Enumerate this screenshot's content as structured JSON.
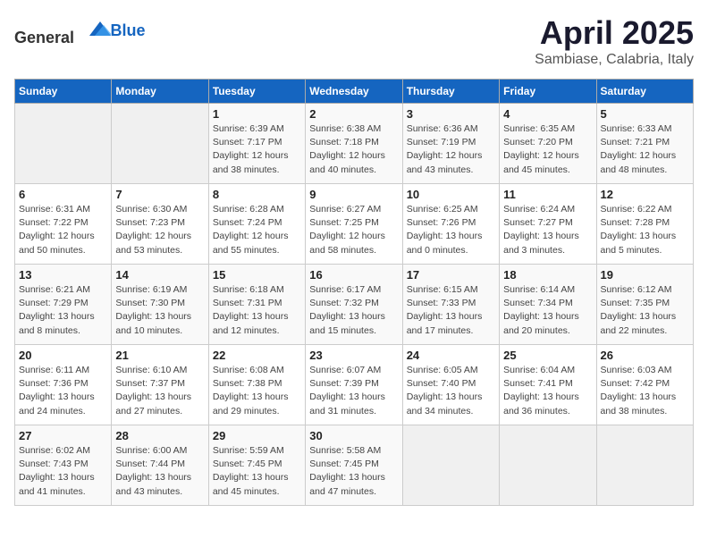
{
  "header": {
    "logo_general": "General",
    "logo_blue": "Blue",
    "month_title": "April 2025",
    "subtitle": "Sambiase, Calabria, Italy"
  },
  "days_of_week": [
    "Sunday",
    "Monday",
    "Tuesday",
    "Wednesday",
    "Thursday",
    "Friday",
    "Saturday"
  ],
  "weeks": [
    [
      {
        "day": "",
        "info": ""
      },
      {
        "day": "",
        "info": ""
      },
      {
        "day": "1",
        "info": "Sunrise: 6:39 AM\nSunset: 7:17 PM\nDaylight: 12 hours and 38 minutes."
      },
      {
        "day": "2",
        "info": "Sunrise: 6:38 AM\nSunset: 7:18 PM\nDaylight: 12 hours and 40 minutes."
      },
      {
        "day": "3",
        "info": "Sunrise: 6:36 AM\nSunset: 7:19 PM\nDaylight: 12 hours and 43 minutes."
      },
      {
        "day": "4",
        "info": "Sunrise: 6:35 AM\nSunset: 7:20 PM\nDaylight: 12 hours and 45 minutes."
      },
      {
        "day": "5",
        "info": "Sunrise: 6:33 AM\nSunset: 7:21 PM\nDaylight: 12 hours and 48 minutes."
      }
    ],
    [
      {
        "day": "6",
        "info": "Sunrise: 6:31 AM\nSunset: 7:22 PM\nDaylight: 12 hours and 50 minutes."
      },
      {
        "day": "7",
        "info": "Sunrise: 6:30 AM\nSunset: 7:23 PM\nDaylight: 12 hours and 53 minutes."
      },
      {
        "day": "8",
        "info": "Sunrise: 6:28 AM\nSunset: 7:24 PM\nDaylight: 12 hours and 55 minutes."
      },
      {
        "day": "9",
        "info": "Sunrise: 6:27 AM\nSunset: 7:25 PM\nDaylight: 12 hours and 58 minutes."
      },
      {
        "day": "10",
        "info": "Sunrise: 6:25 AM\nSunset: 7:26 PM\nDaylight: 13 hours and 0 minutes."
      },
      {
        "day": "11",
        "info": "Sunrise: 6:24 AM\nSunset: 7:27 PM\nDaylight: 13 hours and 3 minutes."
      },
      {
        "day": "12",
        "info": "Sunrise: 6:22 AM\nSunset: 7:28 PM\nDaylight: 13 hours and 5 minutes."
      }
    ],
    [
      {
        "day": "13",
        "info": "Sunrise: 6:21 AM\nSunset: 7:29 PM\nDaylight: 13 hours and 8 minutes."
      },
      {
        "day": "14",
        "info": "Sunrise: 6:19 AM\nSunset: 7:30 PM\nDaylight: 13 hours and 10 minutes."
      },
      {
        "day": "15",
        "info": "Sunrise: 6:18 AM\nSunset: 7:31 PM\nDaylight: 13 hours and 12 minutes."
      },
      {
        "day": "16",
        "info": "Sunrise: 6:17 AM\nSunset: 7:32 PM\nDaylight: 13 hours and 15 minutes."
      },
      {
        "day": "17",
        "info": "Sunrise: 6:15 AM\nSunset: 7:33 PM\nDaylight: 13 hours and 17 minutes."
      },
      {
        "day": "18",
        "info": "Sunrise: 6:14 AM\nSunset: 7:34 PM\nDaylight: 13 hours and 20 minutes."
      },
      {
        "day": "19",
        "info": "Sunrise: 6:12 AM\nSunset: 7:35 PM\nDaylight: 13 hours and 22 minutes."
      }
    ],
    [
      {
        "day": "20",
        "info": "Sunrise: 6:11 AM\nSunset: 7:36 PM\nDaylight: 13 hours and 24 minutes."
      },
      {
        "day": "21",
        "info": "Sunrise: 6:10 AM\nSunset: 7:37 PM\nDaylight: 13 hours and 27 minutes."
      },
      {
        "day": "22",
        "info": "Sunrise: 6:08 AM\nSunset: 7:38 PM\nDaylight: 13 hours and 29 minutes."
      },
      {
        "day": "23",
        "info": "Sunrise: 6:07 AM\nSunset: 7:39 PM\nDaylight: 13 hours and 31 minutes."
      },
      {
        "day": "24",
        "info": "Sunrise: 6:05 AM\nSunset: 7:40 PM\nDaylight: 13 hours and 34 minutes."
      },
      {
        "day": "25",
        "info": "Sunrise: 6:04 AM\nSunset: 7:41 PM\nDaylight: 13 hours and 36 minutes."
      },
      {
        "day": "26",
        "info": "Sunrise: 6:03 AM\nSunset: 7:42 PM\nDaylight: 13 hours and 38 minutes."
      }
    ],
    [
      {
        "day": "27",
        "info": "Sunrise: 6:02 AM\nSunset: 7:43 PM\nDaylight: 13 hours and 41 minutes."
      },
      {
        "day": "28",
        "info": "Sunrise: 6:00 AM\nSunset: 7:44 PM\nDaylight: 13 hours and 43 minutes."
      },
      {
        "day": "29",
        "info": "Sunrise: 5:59 AM\nSunset: 7:45 PM\nDaylight: 13 hours and 45 minutes."
      },
      {
        "day": "30",
        "info": "Sunrise: 5:58 AM\nSunset: 7:45 PM\nDaylight: 13 hours and 47 minutes."
      },
      {
        "day": "",
        "info": ""
      },
      {
        "day": "",
        "info": ""
      },
      {
        "day": "",
        "info": ""
      }
    ]
  ]
}
